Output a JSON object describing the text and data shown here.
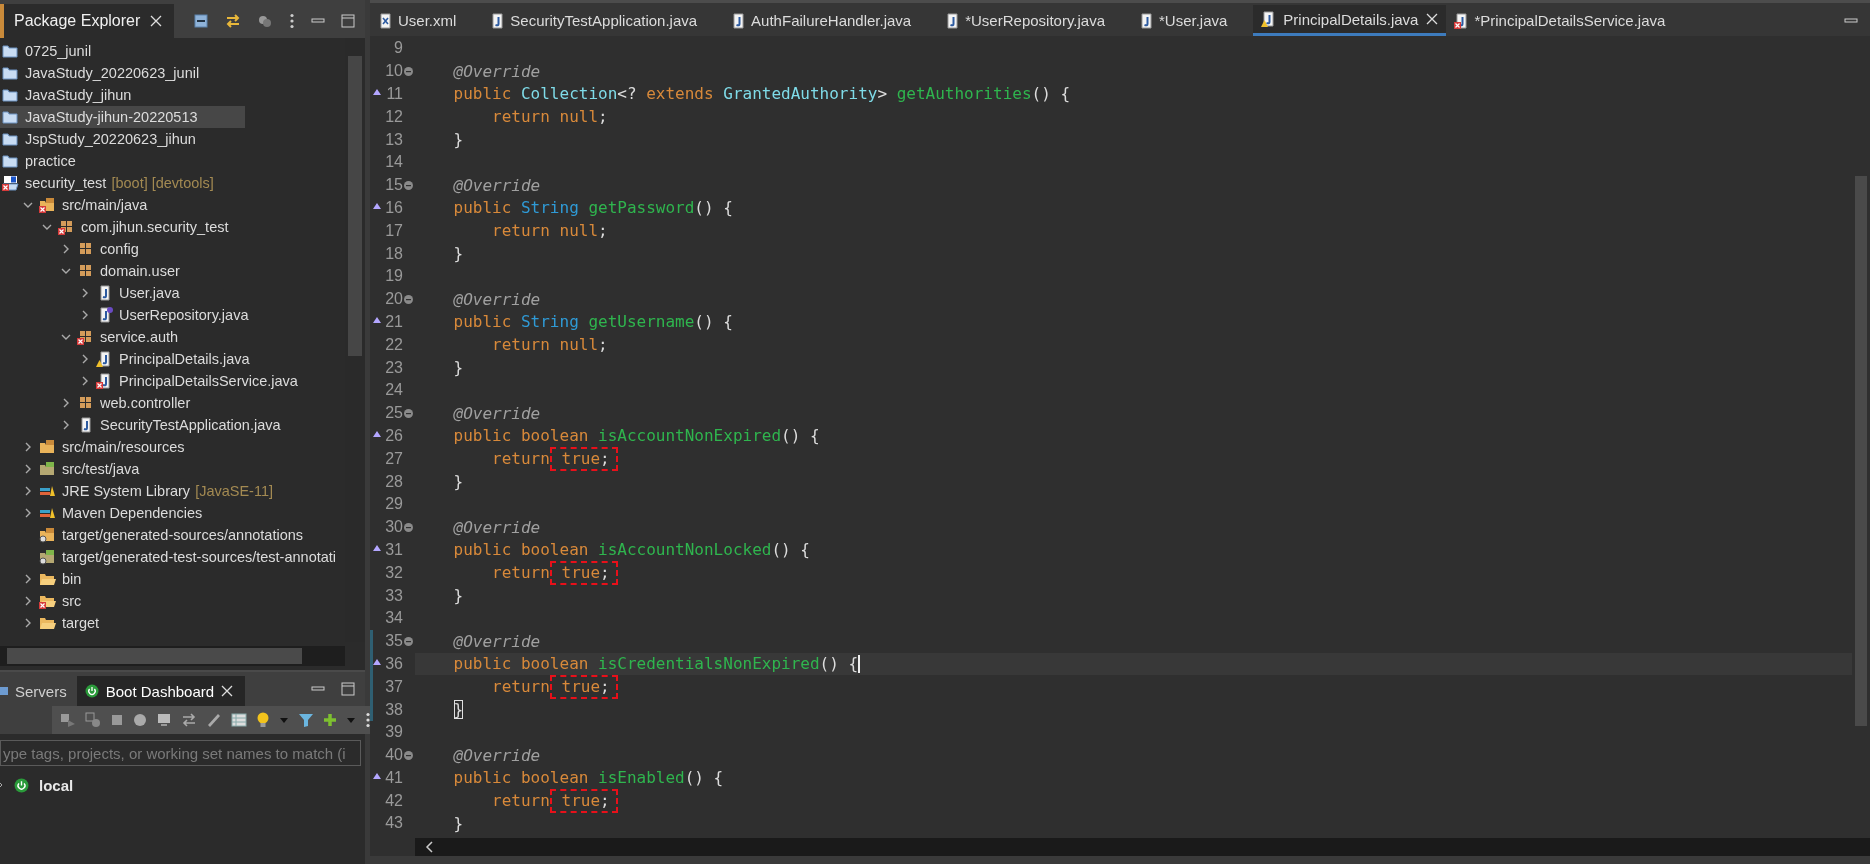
{
  "explorer": {
    "title": "Package Explorer",
    "tree": [
      {
        "label": "0725_junil",
        "kind": "project",
        "error": false,
        "warning": false,
        "selected": false
      },
      {
        "label": "JavaStudy_20220623_junil",
        "kind": "project",
        "error": false,
        "warning": false,
        "selected": false
      },
      {
        "label": "JavaStudy_jihun",
        "kind": "project",
        "error": false,
        "warning": false,
        "selected": false
      },
      {
        "label": "JavaStudy-jihun-20220513",
        "kind": "project",
        "error": false,
        "warning": false,
        "selected": true
      },
      {
        "label": "JspStudy_20220623_jihun",
        "kind": "project",
        "error": false,
        "warning": false,
        "selected": false
      },
      {
        "label": "practice",
        "kind": "project",
        "error": false,
        "warning": false,
        "selected": false
      },
      {
        "label": "security_test",
        "decoration": "[boot] [devtools]",
        "kind": "boot-project",
        "error": true,
        "warning": false,
        "selected": false,
        "children": [
          {
            "label": "src/main/java",
            "kind": "source-folder",
            "error": true,
            "warning": false,
            "expanded": true,
            "selected": false,
            "children": [
              {
                "label": "com.jihun.security_test",
                "kind": "package",
                "error": true,
                "warning": false,
                "expanded": true,
                "selected": false,
                "children": [
                  {
                    "label": "config",
                    "kind": "package",
                    "error": false,
                    "warning": false,
                    "expanded": false,
                    "selected": false
                  },
                  {
                    "label": "domain.user",
                    "kind": "package",
                    "error": false,
                    "warning": false,
                    "expanded": true,
                    "selected": false,
                    "children": [
                      {
                        "label": "User.java",
                        "kind": "java-file",
                        "error": false,
                        "warning": false,
                        "expanded": false,
                        "selected": false
                      },
                      {
                        "label": "UserRepository.java",
                        "kind": "interface-file",
                        "error": false,
                        "warning": false,
                        "expanded": false,
                        "selected": false
                      }
                    ]
                  },
                  {
                    "label": "service.auth",
                    "kind": "package",
                    "error": true,
                    "warning": false,
                    "expanded": true,
                    "selected": false,
                    "children": [
                      {
                        "label": "PrincipalDetails.java",
                        "kind": "java-file",
                        "error": false,
                        "warning": true,
                        "expanded": false,
                        "selected": false
                      },
                      {
                        "label": "PrincipalDetailsService.java",
                        "kind": "java-file",
                        "error": true,
                        "warning": false,
                        "expanded": false,
                        "selected": false
                      }
                    ]
                  },
                  {
                    "label": "web.controller",
                    "kind": "package",
                    "error": false,
                    "warning": false,
                    "expanded": false,
                    "selected": false
                  },
                  {
                    "label": "SecurityTestApplication.java",
                    "kind": "java-file",
                    "error": false,
                    "warning": false,
                    "expanded": false,
                    "selected": false
                  }
                ]
              }
            ]
          },
          {
            "label": "src/main/resources",
            "kind": "source-folder",
            "error": false,
            "warning": false,
            "expanded": false,
            "selected": false
          },
          {
            "label": "src/test/java",
            "kind": "test-folder",
            "error": false,
            "warning": false,
            "expanded": false,
            "selected": false
          },
          {
            "label": "JRE System Library",
            "decoration": "[JavaSE-11]",
            "kind": "library",
            "error": false,
            "warning": false,
            "expanded": false,
            "selected": false
          },
          {
            "label": "Maven Dependencies",
            "kind": "library",
            "error": false,
            "warning": false,
            "expanded": false,
            "selected": false
          },
          {
            "label": "target/generated-sources/annotations",
            "kind": "linked-folder",
            "error": false,
            "warning": false,
            "selected": false
          },
          {
            "label": "target/generated-test-sources/test-annotati",
            "kind": "linked-test-folder",
            "error": false,
            "warning": false,
            "selected": false
          },
          {
            "label": "bin",
            "kind": "folder",
            "error": false,
            "warning": false,
            "expanded": false,
            "selected": false
          },
          {
            "label": "src",
            "kind": "folder",
            "error": true,
            "warning": false,
            "expanded": false,
            "selected": false
          },
          {
            "label": "target",
            "kind": "folder",
            "error": false,
            "warning": false,
            "expanded": false,
            "selected": false
          }
        ]
      }
    ]
  },
  "dashboard": {
    "tabs": [
      {
        "label": "Servers",
        "selected": false
      },
      {
        "label": "Boot Dashboard",
        "selected": true
      }
    ],
    "filter": {
      "placeholder": "ype tags, projects, or working set names to match (i"
    },
    "items": [
      {
        "label": "local",
        "expanded": false
      }
    ]
  },
  "editor": {
    "tabs": [
      {
        "label": "User.xml",
        "kind": "xml-file",
        "error": false,
        "warning": false,
        "selected": false
      },
      {
        "label": "SecurityTestApplication.java",
        "kind": "java-file",
        "error": false,
        "warning": false,
        "selected": false
      },
      {
        "label": "AuthFailureHandler.java",
        "kind": "java-file",
        "error": false,
        "warning": false,
        "selected": false
      },
      {
        "label": "*UserRepository.java",
        "kind": "java-file",
        "error": false,
        "warning": false,
        "selected": false
      },
      {
        "label": "*User.java",
        "kind": "java-file",
        "error": false,
        "warning": false,
        "selected": false
      },
      {
        "label": "PrincipalDetails.java",
        "kind": "java-file",
        "error": false,
        "warning": true,
        "selected": true
      },
      {
        "label": "*PrincipalDetailsService.java",
        "kind": "java-file",
        "error": true,
        "warning": false,
        "selected": false
      }
    ],
    "lines": [
      {
        "number": "9",
        "kind": "plain",
        "changed": false,
        "current": false
      },
      {
        "number": "10",
        "kind": "fold",
        "changed": false,
        "current": false,
        "tokens": [
          {
            "kind": "annotation",
            "text": "    @Override"
          }
        ]
      },
      {
        "number": "11",
        "kind": "override",
        "changed": false,
        "current": false,
        "tokens": [
          {
            "kind": "keyword",
            "text": "    public"
          },
          {
            "kind": "interface",
            "text": " Collection"
          },
          {
            "kind": "plain",
            "text": "<? "
          },
          {
            "kind": "keyword",
            "text": "extends"
          },
          {
            "kind": "interface",
            "text": " GrantedAuthority"
          },
          {
            "kind": "plain",
            "text": "> "
          },
          {
            "kind": "method",
            "text": "getAuthorities"
          },
          {
            "kind": "plain",
            "text": "() {"
          }
        ]
      },
      {
        "number": "12",
        "kind": "plain",
        "changed": false,
        "current": false,
        "tokens": [
          {
            "kind": "keyword",
            "text": "        return"
          },
          {
            "kind": "keyword",
            "text": " null"
          },
          {
            "kind": "plain",
            "text": ";"
          }
        ]
      },
      {
        "number": "13",
        "kind": "plain",
        "changed": false,
        "current": false,
        "tokens": [
          {
            "kind": "plain",
            "text": "    }"
          }
        ]
      },
      {
        "number": "14",
        "kind": "plain",
        "changed": false,
        "current": false
      },
      {
        "number": "15",
        "kind": "fold",
        "changed": false,
        "current": false,
        "tokens": [
          {
            "kind": "annotation",
            "text": "    @Override"
          }
        ]
      },
      {
        "number": "16",
        "kind": "override",
        "changed": false,
        "current": false,
        "tokens": [
          {
            "kind": "keyword",
            "text": "    public"
          },
          {
            "kind": "class",
            "text": " String"
          },
          {
            "kind": "method",
            "text": " getPassword"
          },
          {
            "kind": "plain",
            "text": "() {"
          }
        ]
      },
      {
        "number": "17",
        "kind": "plain",
        "changed": false,
        "current": false,
        "tokens": [
          {
            "kind": "keyword",
            "text": "        return"
          },
          {
            "kind": "keyword",
            "text": " null"
          },
          {
            "kind": "plain",
            "text": ";"
          }
        ]
      },
      {
        "number": "18",
        "kind": "plain",
        "changed": false,
        "current": false,
        "tokens": [
          {
            "kind": "plain",
            "text": "    }"
          }
        ]
      },
      {
        "number": "19",
        "kind": "plain",
        "changed": false,
        "current": false
      },
      {
        "number": "20",
        "kind": "fold",
        "changed": false,
        "current": false,
        "tokens": [
          {
            "kind": "annotation",
            "text": "    @Override"
          }
        ]
      },
      {
        "number": "21",
        "kind": "override",
        "changed": false,
        "current": false,
        "tokens": [
          {
            "kind": "keyword",
            "text": "    public"
          },
          {
            "kind": "class",
            "text": " String"
          },
          {
            "kind": "method",
            "text": " getUsername"
          },
          {
            "kind": "plain",
            "text": "() {"
          }
        ]
      },
      {
        "number": "22",
        "kind": "plain",
        "changed": false,
        "current": false,
        "tokens": [
          {
            "kind": "keyword",
            "text": "        return"
          },
          {
            "kind": "keyword",
            "text": " null"
          },
          {
            "kind": "plain",
            "text": ";"
          }
        ]
      },
      {
        "number": "23",
        "kind": "plain",
        "changed": false,
        "current": false,
        "tokens": [
          {
            "kind": "plain",
            "text": "    }"
          }
        ]
      },
      {
        "number": "24",
        "kind": "plain",
        "changed": false,
        "current": false
      },
      {
        "number": "25",
        "kind": "fold",
        "changed": false,
        "current": false,
        "tokens": [
          {
            "kind": "annotation",
            "text": "    @Override"
          }
        ]
      },
      {
        "number": "26",
        "kind": "override",
        "changed": false,
        "current": false,
        "tokens": [
          {
            "kind": "keyword",
            "text": "    public"
          },
          {
            "kind": "keyword",
            "text": " boolean"
          },
          {
            "kind": "method",
            "text": " isAccountNonExpired"
          },
          {
            "kind": "plain",
            "text": "() {"
          }
        ]
      },
      {
        "number": "27",
        "kind": "plain",
        "changed": false,
        "current": false,
        "tokens": [
          {
            "kind": "keyword",
            "text": "        return"
          },
          {
            "kind": "keyword",
            "text": " true",
            "boxed": true
          },
          {
            "kind": "plain",
            "text": ";",
            "boxed": true
          }
        ]
      },
      {
        "number": "28",
        "kind": "plain",
        "changed": false,
        "current": false,
        "tokens": [
          {
            "kind": "plain",
            "text": "    }"
          }
        ]
      },
      {
        "number": "29",
        "kind": "plain",
        "changed": false,
        "current": false
      },
      {
        "number": "30",
        "kind": "fold",
        "changed": false,
        "current": false,
        "tokens": [
          {
            "kind": "annotation",
            "text": "    @Override"
          }
        ]
      },
      {
        "number": "31",
        "kind": "override",
        "changed": false,
        "current": false,
        "tokens": [
          {
            "kind": "keyword",
            "text": "    public"
          },
          {
            "kind": "keyword",
            "text": " boolean"
          },
          {
            "kind": "method",
            "text": " isAccountNonLocked"
          },
          {
            "kind": "plain",
            "text": "() {"
          }
        ]
      },
      {
        "number": "32",
        "kind": "plain",
        "changed": false,
        "current": false,
        "tokens": [
          {
            "kind": "keyword",
            "text": "        return"
          },
          {
            "kind": "keyword",
            "text": " true",
            "boxed": true
          },
          {
            "kind": "plain",
            "text": ";",
            "boxed": true
          }
        ]
      },
      {
        "number": "33",
        "kind": "plain",
        "changed": false,
        "current": false,
        "tokens": [
          {
            "kind": "plain",
            "text": "    }"
          }
        ]
      },
      {
        "number": "34",
        "kind": "plain",
        "changed": false,
        "current": false
      },
      {
        "number": "35",
        "kind": "fold",
        "changed": true,
        "current": false,
        "tokens": [
          {
            "kind": "annotation",
            "text": "    @Override"
          }
        ]
      },
      {
        "number": "36",
        "kind": "override",
        "changed": true,
        "current": true,
        "tokens": [
          {
            "kind": "keyword",
            "text": "    public"
          },
          {
            "kind": "keyword",
            "text": " boolean"
          },
          {
            "kind": "method",
            "text": " isCredentialsNonExpired"
          },
          {
            "kind": "plain",
            "text": "() {"
          }
        ]
      },
      {
        "number": "37",
        "kind": "plain",
        "changed": true,
        "current": false,
        "tokens": [
          {
            "kind": "keyword",
            "text": "        return"
          },
          {
            "kind": "keyword",
            "text": " true",
            "boxed": true
          },
          {
            "kind": "plain",
            "text": ";",
            "boxed": true
          }
        ]
      },
      {
        "number": "38",
        "kind": "plain",
        "changed": true,
        "current": false,
        "tokens": [
          {
            "kind": "matched-bracket",
            "text": "    }"
          }
        ]
      },
      {
        "number": "39",
        "kind": "plain",
        "changed": false,
        "current": false
      },
      {
        "number": "40",
        "kind": "fold",
        "changed": false,
        "current": false,
        "tokens": [
          {
            "kind": "annotation",
            "text": "    @Override"
          }
        ]
      },
      {
        "number": "41",
        "kind": "override",
        "changed": false,
        "current": false,
        "tokens": [
          {
            "kind": "keyword",
            "text": "    public"
          },
          {
            "kind": "keyword",
            "text": " boolean"
          },
          {
            "kind": "method",
            "text": " isEnabled"
          },
          {
            "kind": "plain",
            "text": "() {"
          }
        ]
      },
      {
        "number": "42",
        "kind": "plain",
        "changed": false,
        "current": false,
        "tokens": [
          {
            "kind": "keyword",
            "text": "        return"
          },
          {
            "kind": "keyword",
            "text": " true",
            "boxed": true
          },
          {
            "kind": "plain",
            "text": ";",
            "boxed": true
          }
        ]
      },
      {
        "number": "43",
        "kind": "plain",
        "changed": false,
        "current": false,
        "tokens": [
          {
            "kind": "plain",
            "text": "    }"
          }
        ]
      }
    ]
  }
}
